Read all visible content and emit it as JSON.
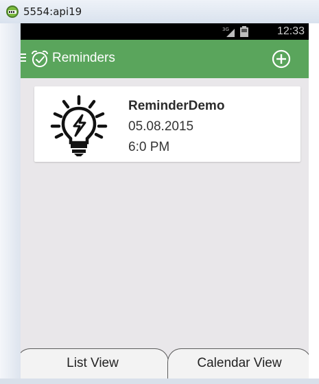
{
  "window": {
    "title": "5554:api19",
    "icon": "android-emulator-icon"
  },
  "status_bar": {
    "network": "3G",
    "time": "12:33"
  },
  "action_bar": {
    "title": "Reminders",
    "background": "#5aa55c"
  },
  "reminders": [
    {
      "title": "ReminderDemo",
      "date": "05.08.2015",
      "time": "6:0 PM",
      "icon": "lightbulb-icon"
    }
  ],
  "tabs": {
    "list_label": "List View",
    "calendar_label": "Calendar View"
  }
}
